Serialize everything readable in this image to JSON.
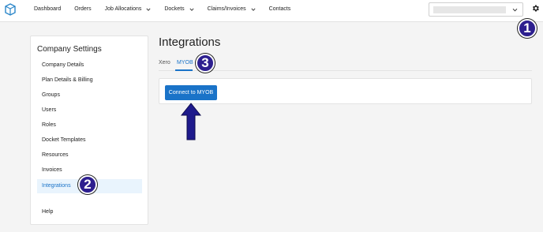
{
  "header": {
    "logo_icon": "box-logo-icon",
    "nav": [
      {
        "label": "Dashboard",
        "dropdown": false
      },
      {
        "label": "Orders",
        "dropdown": false
      },
      {
        "label": "Job Allocations",
        "dropdown": true
      },
      {
        "label": "Dockets",
        "dropdown": true
      },
      {
        "label": "Claims/Invoices",
        "dropdown": true
      },
      {
        "label": "Contacts",
        "dropdown": false
      }
    ],
    "company_select_icon": "chevron-down-icon",
    "settings_icon": "gear-icon"
  },
  "sidebar": {
    "title": "Company Settings",
    "items": [
      {
        "label": "Company Details"
      },
      {
        "label": "Plan Details & Billing"
      },
      {
        "label": "Groups"
      },
      {
        "label": "Users"
      },
      {
        "label": "Roles"
      },
      {
        "label": "Docket Templates"
      },
      {
        "label": "Resources"
      },
      {
        "label": "Invoices"
      },
      {
        "label": "Integrations",
        "active": true
      },
      {
        "label": "Help"
      }
    ]
  },
  "main": {
    "title": "Integrations",
    "tabs": [
      {
        "label": "Xero",
        "active": false
      },
      {
        "label": "MYOB",
        "active": true
      }
    ],
    "connect_button": "Connect to MYOB"
  },
  "annotations": {
    "badges": [
      "1",
      "2",
      "3"
    ],
    "arrow_icon": "up-arrow-icon"
  },
  "colors": {
    "accent": "#1a73c8",
    "active_bg": "#e9f4fd",
    "badge": "#2d1f8f",
    "arrow": "#1e1a8c"
  }
}
